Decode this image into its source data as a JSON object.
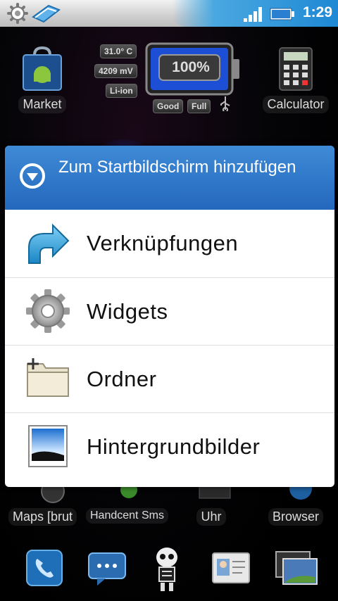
{
  "status_bar": {
    "time": "1:29"
  },
  "home": {
    "apps_top": [
      {
        "label": "Market"
      },
      {
        "label": "Calculator"
      }
    ],
    "battery_widget": {
      "temperature": "31.0° C",
      "voltage": "4209 mV",
      "type": "Li-ion",
      "level": "100%",
      "level_fraction": 1.0,
      "health": "Good",
      "status": "Full"
    },
    "apps_bottom": [
      {
        "label": "Maps [brut"
      },
      {
        "label": "Handcent Sms"
      },
      {
        "label": "Uhr"
      },
      {
        "label": "Browser"
      }
    ]
  },
  "dialog": {
    "title": "Zum Startbildschirm hinzufügen",
    "items": [
      {
        "label": "Verknüpfungen",
        "icon": "shortcut-arrow-icon"
      },
      {
        "label": "Widgets",
        "icon": "gear-icon"
      },
      {
        "label": "Ordner",
        "icon": "folder-icon"
      },
      {
        "label": "Hintergrundbilder",
        "icon": "wallpaper-icon"
      }
    ]
  },
  "dock": [
    {
      "icon": "phone-icon"
    },
    {
      "icon": "messaging-icon"
    },
    {
      "icon": "skeleton-icon"
    },
    {
      "icon": "contacts-icon"
    },
    {
      "icon": "gallery-icon"
    }
  ],
  "colors": {
    "accent": "#2a6fc4",
    "status_blue": "#1f88d4"
  }
}
